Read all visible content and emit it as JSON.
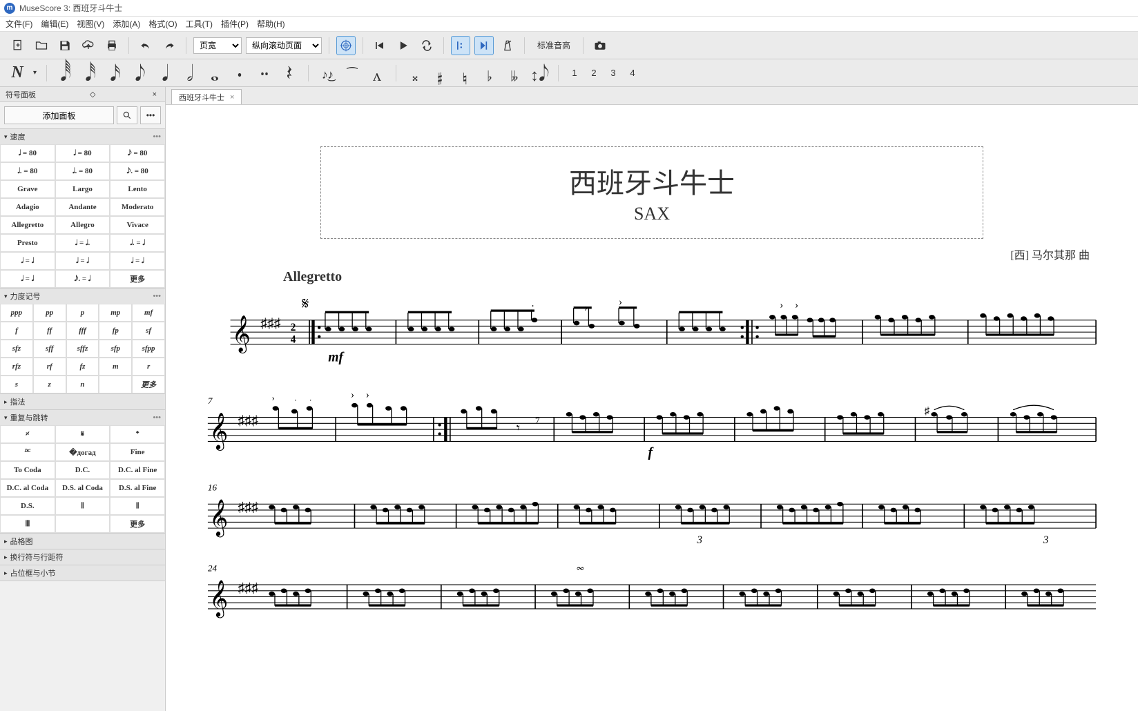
{
  "app": {
    "name": "MuseScore 3",
    "document": "西班牙斗牛士",
    "logo_text": "m"
  },
  "menubar": [
    "文件(F)",
    "编辑(E)",
    "视图(V)",
    "添加(A)",
    "格式(O)",
    "工具(T)",
    "插件(P)",
    "帮助(H)"
  ],
  "toolbar1": {
    "zoom_select": "页宽",
    "scroll_select": "纵向滚动页面",
    "pitch_label": "标准音高"
  },
  "toolbar2": {
    "voices": [
      "1",
      "2",
      "3",
      "4"
    ]
  },
  "sidebar": {
    "title": "符号面板",
    "add_label": "添加面板",
    "sections": {
      "tempo": {
        "title": "速度",
        "cells": [
          "𝅗𝅥 = 80",
          "𝅘𝅥 = 80",
          "𝅘𝅥𝅮 = 80",
          "𝅗𝅥. = 80",
          "𝅘𝅥. = 80",
          "𝅘𝅥𝅮. = 80",
          "Grave",
          "Largo",
          "Lento",
          "Adagio",
          "Andante",
          "Moderato",
          "Allegretto",
          "Allegro",
          "Vivace",
          "Presto",
          "𝅘𝅥 = 𝅘𝅥.",
          "𝅘𝅥. = 𝅘𝅥",
          "𝅗𝅥 = 𝅘𝅥",
          "𝅘𝅥 = 𝅗𝅥",
          "𝅘𝅥 = 𝅘𝅥",
          "𝅘𝅥 = 𝅘𝅥",
          "𝅘𝅥𝅮. = 𝅘𝅥",
          "更多"
        ]
      },
      "dynamics": {
        "title": "力度记号",
        "cells": [
          "ppp",
          "pp",
          "p",
          "mp",
          "mf",
          "f",
          "ff",
          "fff",
          "fp",
          "sf",
          "sfz",
          "sff",
          "sffz",
          "sfp",
          "sfpp",
          "rfz",
          "rf",
          "fz",
          "m",
          "r",
          "s",
          "z",
          "n",
          "",
          "更多"
        ]
      },
      "fingering": {
        "title": "指法"
      },
      "repeats": {
        "title": "重复与跳转",
        "cells": [
          "𝄎",
          "𝄋",
          "𝄌",
          "𝄊",
          "�догад",
          "Fine",
          "To Coda",
          "D.C.",
          "D.C. al Fine",
          "D.C. al Coda",
          "D.S. al Coda",
          "D.S. al Fine",
          "D.S.",
          "𝄀𝄂",
          "𝄃𝄀",
          "𝄂𝄀𝄂",
          "",
          "更多"
        ]
      },
      "others": [
        "品格图",
        "换行符与行距符",
        "占位框与小节"
      ]
    }
  },
  "tabs": [
    {
      "label": "西班牙斗牛士",
      "closable": true
    }
  ],
  "score": {
    "title": "西班牙斗牛士",
    "subtitle": "SAX",
    "composer": "[西] 马尔其那 曲",
    "tempo_text": "Allegretto",
    "segno": "𝄋",
    "dynamic1": "mf",
    "dynamic2": "f",
    "measure_numbers": [
      "7",
      "16",
      "24"
    ],
    "tuplet": "3",
    "time_sig": "2/4",
    "key_sig_sharps": 3
  }
}
